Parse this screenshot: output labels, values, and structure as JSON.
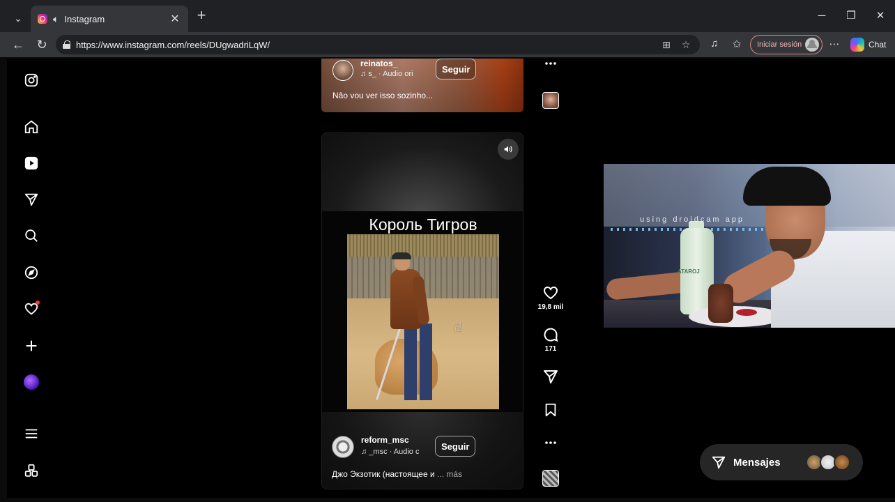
{
  "browser": {
    "tab_title": "Instagram",
    "url": "https://www.instagram.com/reels/DUgwadriLqW/",
    "signin_label": "Iniciar sesión",
    "chat_label": "Chat"
  },
  "reels": {
    "previous": {
      "username": "reinatos_",
      "audio": "s_ · Audio ori",
      "follow_label": "Seguir",
      "caption": "Não vou ver isso sozinho..."
    },
    "current": {
      "video_title": "Король Тигров",
      "username": "reform_msc",
      "audio": "_msc · Audio c",
      "follow_label": "Seguir",
      "caption": "Джо Экзотик (настоящее и",
      "more_label": "... más",
      "likes": "19,8 mil",
      "comments": "171"
    }
  },
  "webcam": {
    "watermark": "using droidcam app",
    "bottle_label": "ATAROJ"
  },
  "messages": {
    "label": "Mensajes"
  },
  "colors": {
    "browser_tabbar": "#202124",
    "browser_toolbar": "#35363a",
    "page_background": "#000000",
    "notification_dot": "#ff3040",
    "signin_border": "#e08a86"
  }
}
